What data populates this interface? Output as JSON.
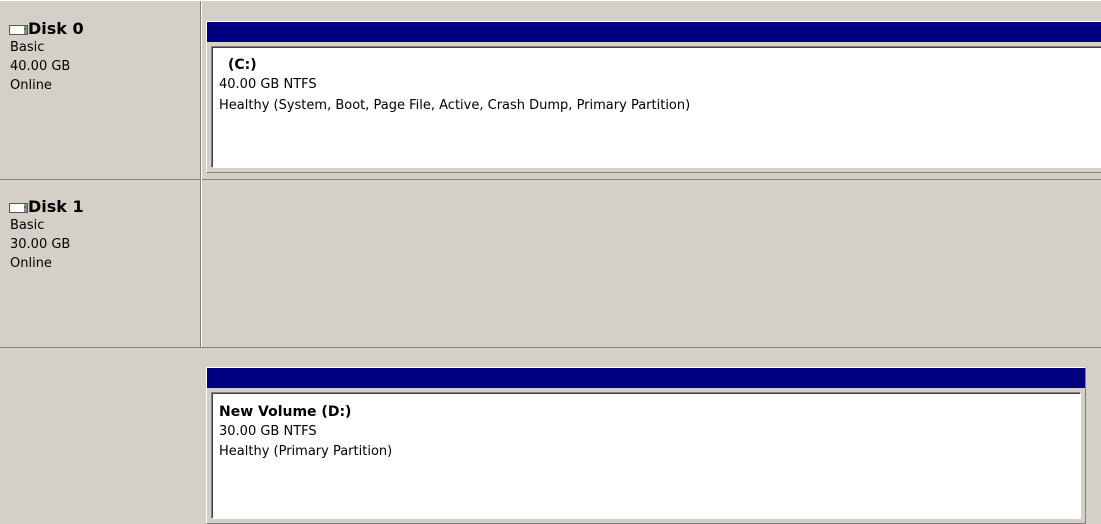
{
  "disks": [
    {
      "title": "Disk 0",
      "type": "Basic",
      "size": "40.00 GB",
      "status": "Online",
      "volume": {
        "name": "(C:)",
        "size_fs": "40.00 GB NTFS",
        "health": "Healthy (System, Boot, Page File, Active, Crash Dump, Primary Partition)"
      }
    },
    {
      "title": "Disk 1",
      "type": "Basic",
      "size": "30.00 GB",
      "status": "Online",
      "volume": {
        "name": "New Volume  (D:)",
        "size_fs": "30.00 GB NTFS",
        "health": "Healthy (Primary Partition)"
      }
    }
  ],
  "colors": {
    "panel_bg": "#d4d0c8",
    "volume_header": "#000080",
    "volume_body": "#ffffff"
  },
  "icons": {
    "disk": "disk-drive-icon"
  }
}
